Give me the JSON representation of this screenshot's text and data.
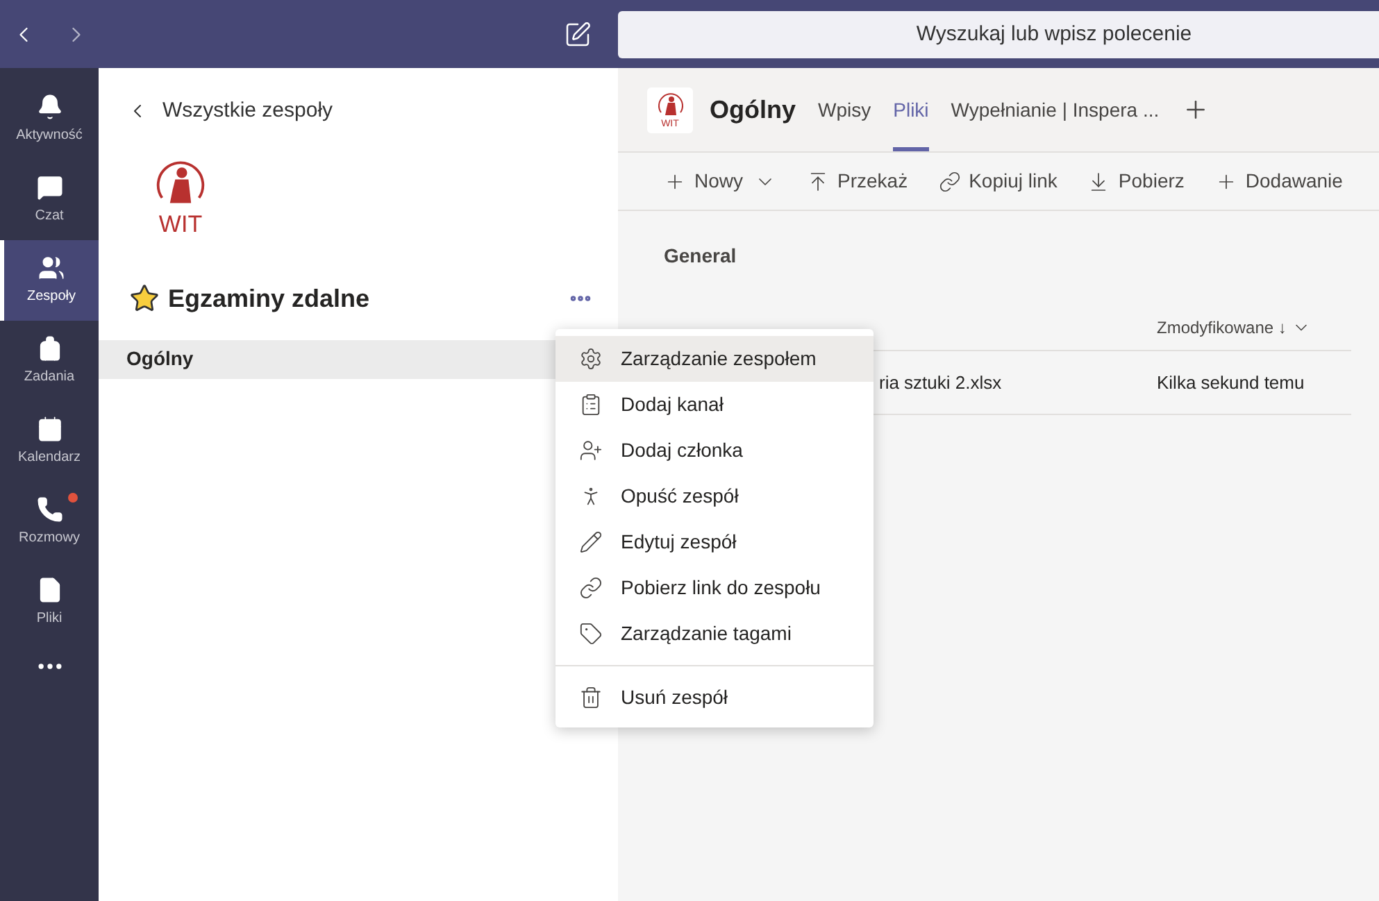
{
  "top_bar": {
    "search": {
      "placeholder": "Wyszukaj lub wpisz polecenie"
    }
  },
  "rail": [
    {
      "label": "Aktywność",
      "selected": false,
      "badge": false
    },
    {
      "label": "Czat",
      "selected": false,
      "badge": false
    },
    {
      "label": "Zespoły",
      "selected": true,
      "badge": false
    },
    {
      "label": "Zadania",
      "selected": false,
      "badge": false
    },
    {
      "label": "Kalendarz",
      "selected": false,
      "badge": false
    },
    {
      "label": "Rozmowy",
      "selected": false,
      "badge": true
    },
    {
      "label": "Pliki",
      "selected": false,
      "badge": false
    }
  ],
  "team_panel": {
    "back_link": "Wszystkie zespoły",
    "logo_text": "WIT",
    "team_name": "Egzaminy zdalne",
    "favorite": true,
    "channels": [
      {
        "name": "Ogólny",
        "selected": true
      }
    ]
  },
  "channel_header": {
    "logo_text": "WIT",
    "title": "Ogólny",
    "tabs": [
      {
        "label": "Wpisy",
        "selected": false
      },
      {
        "label": "Pliki",
        "selected": true
      },
      {
        "label": "Wypełnianie | Inspera ...",
        "selected": false
      }
    ]
  },
  "toolbar": [
    {
      "label": "Nowy",
      "dropdown": true
    },
    {
      "label": "Przekaż",
      "dropdown": false
    },
    {
      "label": "Kopiuj link",
      "dropdown": false
    },
    {
      "label": "Pobierz",
      "dropdown": false
    },
    {
      "label": "Dodawanie",
      "dropdown": false
    }
  ],
  "files": {
    "folder": "General",
    "columns": [
      {
        "label": "Zmodyfikowane ↓"
      }
    ],
    "rows": [
      {
        "name": "ria sztuki 2.xlsx",
        "modified": "Kilka sekund temu"
      }
    ]
  },
  "menu": {
    "groups": [
      [
        {
          "label": "Zarządzanie zespołem",
          "selected": true
        },
        {
          "label": "Dodaj kanał",
          "selected": false
        },
        {
          "label": "Dodaj członka",
          "selected": false
        },
        {
          "label": "Opuść zespół",
          "selected": false
        },
        {
          "label": "Edytuj zespół",
          "selected": false
        },
        {
          "label": "Pobierz link do zespołu",
          "selected": false
        },
        {
          "label": "Zarządzanie tagami",
          "selected": false
        }
      ],
      [
        {
          "label": "Usuń zespół",
          "selected": false
        }
      ]
    ]
  }
}
